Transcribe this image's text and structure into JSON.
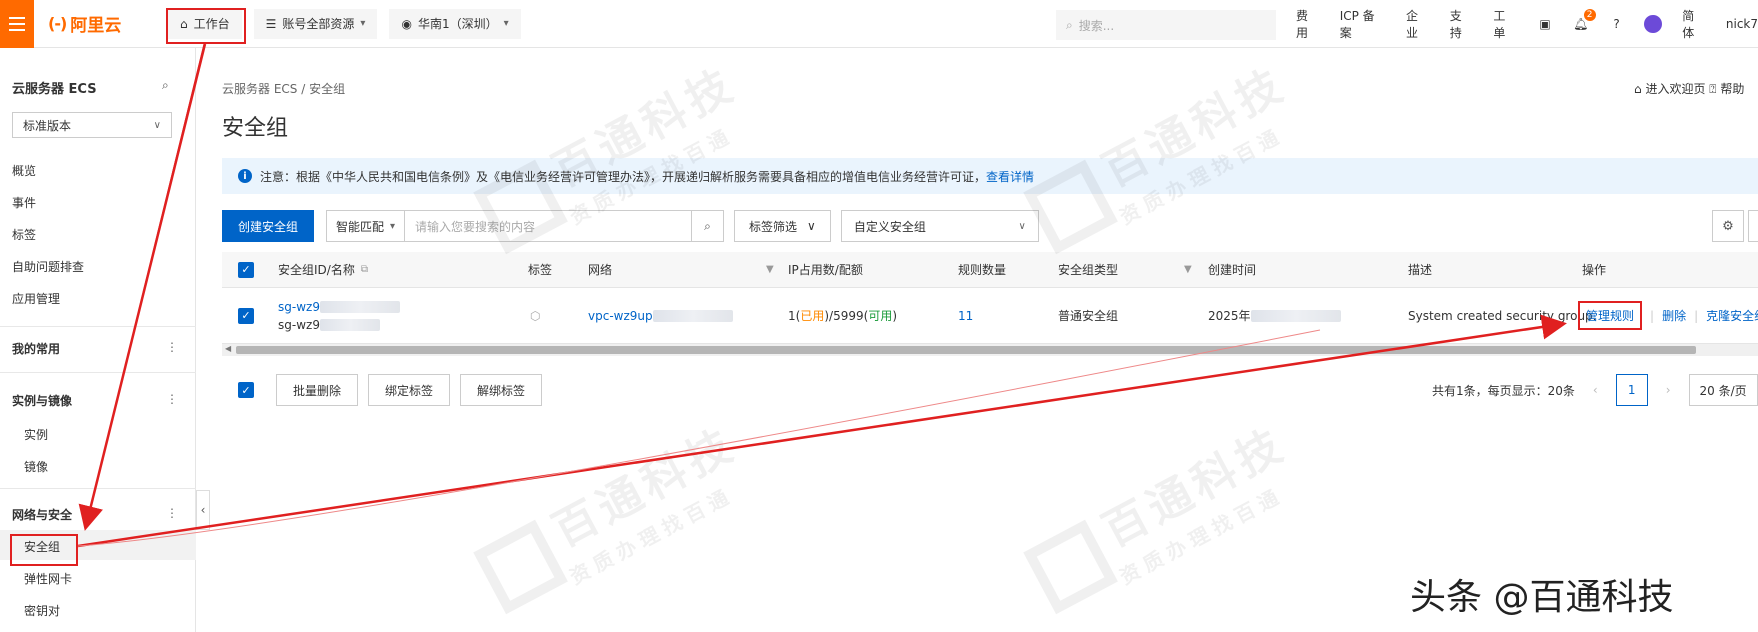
{
  "topbar": {
    "logo_mark": "(-)",
    "logo_text": "阿里云",
    "workbench": "工作台",
    "resources": "账号全部资源",
    "region": "华南1（深圳）",
    "search_placeholder": "搜索...",
    "links": [
      "费用",
      "ICP 备案",
      "企业",
      "支持",
      "工单"
    ],
    "notification_count": "2",
    "language": "简体",
    "user": "nick7"
  },
  "sidebar": {
    "title": "云服务器 ECS",
    "version": "标准版本",
    "items": [
      "概览",
      "事件",
      "标签",
      "自助问题排查",
      "应用管理"
    ],
    "favorites": "我的常用",
    "group_instances": "实例与镜像",
    "instances_items": [
      "实例",
      "镜像"
    ],
    "group_network": "网络与安全",
    "network_items": [
      "安全组",
      "弹性网卡",
      "密钥对"
    ]
  },
  "main": {
    "breadcrumb": "云服务器 ECS  /  安全组",
    "welcome": "进入欢迎页",
    "help": "帮助",
    "title": "安全组",
    "notice": "注意：根据《中华人民共和国电信条例》及《电信业务经营许可管理办法》，开展递归解析服务需要具备相应的增值电信业务经营许可证，",
    "notice_link": "查看详情",
    "create_button": "创建安全组",
    "smart_match": "智能匹配",
    "search_placeholder": "请输入您要搜索的内容",
    "tag_filter": "标签筛选",
    "custom_sg": "自定义安全组"
  },
  "table": {
    "headers": {
      "id": "安全组ID/名称",
      "tag": "标签",
      "network": "网络",
      "ip": "IP占用数/配额",
      "rules": "规则数量",
      "type": "安全组类型",
      "created": "创建时间",
      "desc": "描述",
      "ops": "操作"
    },
    "row": {
      "id": "sg-wz9",
      "name": "sg-wz9",
      "network": "vpc-wz9up",
      "ip_used_count": "1",
      "ip_used_label": "已用",
      "ip_quota": "5999",
      "ip_avail_label": "可用",
      "rules": "11",
      "type": "普通安全组",
      "created": "2025年",
      "desc": "System created security group.",
      "op_manage": "管理规则",
      "op_delete": "删除",
      "op_clone": "克隆安全组"
    }
  },
  "bottom": {
    "batch_delete": "批量删除",
    "bind_tag": "绑定标签",
    "unbind_tag": "解绑标签",
    "summary": "共有1条，每页显示：20条",
    "page": "1",
    "page_size": "20 条/页"
  },
  "watermark": {
    "big": "百通科技",
    "small": "资质办理找百通",
    "footer": "头条 @百通科技"
  },
  "colors": {
    "brand": "#ff6a00",
    "primary": "#0064c8",
    "highlight": "#e02020"
  }
}
